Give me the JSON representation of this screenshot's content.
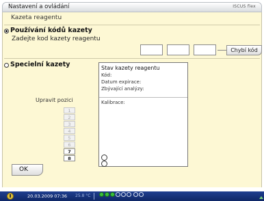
{
  "header": {
    "title": "Nastavení a ovládání",
    "brand": "ISCUS flex"
  },
  "page": {
    "subtitle": "Kazeta reagentu"
  },
  "option1": {
    "label": "Používání kódů kazety",
    "instruction": "Zadejte kod kazety reagentu",
    "code_fields": [
      "",
      "",
      ""
    ],
    "missing_code_button": "Chybí kód"
  },
  "option2": {
    "label": "Specielní kazety"
  },
  "status": {
    "title": "Stav kazety reagentu",
    "code_label": "Kód:",
    "expiry_label": "Datum expirace:",
    "remaining_label": "Zbývající analýzy:",
    "calibration_label": "Kalibrace:"
  },
  "positions": {
    "label": "Upravit pozici",
    "buttons": [
      "1",
      "2",
      "3",
      "4",
      "5",
      "6",
      "7",
      "8"
    ]
  },
  "ok_button": "OK",
  "taskbar": {
    "datetime": "20.03.2009 07:36",
    "temperature": "25.8 °C"
  }
}
